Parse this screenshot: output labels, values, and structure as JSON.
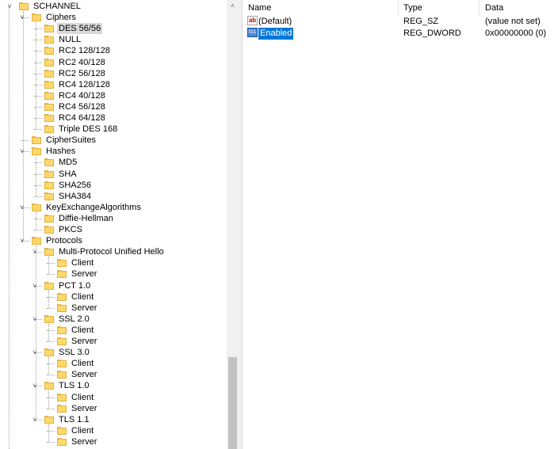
{
  "tree": {
    "rows": [
      {
        "label": "SCHANNEL",
        "expander": "˅",
        "selected": false
      },
      {
        "label": "Ciphers",
        "expander": "˅",
        "selected": false
      },
      {
        "label": "DES 56/56",
        "expander": "",
        "selected": true
      },
      {
        "label": "NULL",
        "expander": "",
        "selected": false
      },
      {
        "label": "RC2 128/128",
        "expander": "",
        "selected": false
      },
      {
        "label": "RC2 40/128",
        "expander": "",
        "selected": false
      },
      {
        "label": "RC2 56/128",
        "expander": "",
        "selected": false
      },
      {
        "label": "RC4 128/128",
        "expander": "",
        "selected": false
      },
      {
        "label": "RC4 40/128",
        "expander": "",
        "selected": false
      },
      {
        "label": "RC4 56/128",
        "expander": "",
        "selected": false
      },
      {
        "label": "RC4 64/128",
        "expander": "",
        "selected": false
      },
      {
        "label": "Triple DES 168",
        "expander": "",
        "selected": false
      },
      {
        "label": "CipherSuites",
        "expander": "",
        "selected": false
      },
      {
        "label": "Hashes",
        "expander": "˅",
        "selected": false
      },
      {
        "label": "MD5",
        "expander": "",
        "selected": false
      },
      {
        "label": "SHA",
        "expander": "",
        "selected": false
      },
      {
        "label": "SHA256",
        "expander": "",
        "selected": false
      },
      {
        "label": "SHA384",
        "expander": "",
        "selected": false
      },
      {
        "label": "KeyExchangeAlgorithms",
        "expander": "˅",
        "selected": false
      },
      {
        "label": "Diffie-Hellman",
        "expander": "",
        "selected": false
      },
      {
        "label": "PKCS",
        "expander": "",
        "selected": false
      },
      {
        "label": "Protocols",
        "expander": "˅",
        "selected": false
      },
      {
        "label": "Multi-Protocol Unified Hello",
        "expander": "˅",
        "selected": false
      },
      {
        "label": "Client",
        "expander": "",
        "selected": false
      },
      {
        "label": "Server",
        "expander": "",
        "selected": false
      },
      {
        "label": "PCT 1.0",
        "expander": "˅",
        "selected": false
      },
      {
        "label": "Client",
        "expander": "",
        "selected": false
      },
      {
        "label": "Server",
        "expander": "",
        "selected": false
      },
      {
        "label": "SSL 2.0",
        "expander": "˅",
        "selected": false
      },
      {
        "label": "Client",
        "expander": "",
        "selected": false
      },
      {
        "label": "Server",
        "expander": "",
        "selected": false
      },
      {
        "label": "SSL 3.0",
        "expander": "˅",
        "selected": false
      },
      {
        "label": "Client",
        "expander": "",
        "selected": false
      },
      {
        "label": "Server",
        "expander": "",
        "selected": false
      },
      {
        "label": "TLS 1.0",
        "expander": "˅",
        "selected": false
      },
      {
        "label": "Client",
        "expander": "",
        "selected": false
      },
      {
        "label": "Server",
        "expander": "",
        "selected": false
      },
      {
        "label": "TLS 1.1",
        "expander": "˅",
        "selected": false
      },
      {
        "label": "Client",
        "expander": "",
        "selected": false
      },
      {
        "label": "Server",
        "expander": "",
        "selected": false
      }
    ]
  },
  "scrollbar": {
    "up_arrow": "˄",
    "down_arrow": "˅"
  },
  "list": {
    "columns": {
      "name": "Name",
      "type": "Type",
      "data": "Data"
    },
    "rows": [
      {
        "icon": "ab",
        "icon_name": "string-value-icon",
        "name": "(Default)",
        "type": "REG_SZ",
        "data": "(value not set)",
        "selected": false
      },
      {
        "icon": "011",
        "icon_name": "binary-value-icon",
        "name": "Enabled",
        "type": "REG_DWORD",
        "data": "0x00000000 (0)",
        "selected": true
      }
    ]
  },
  "colors": {
    "selection": "#0078d7",
    "tree_selection": "#d9d9d9",
    "folder": "#ffd86b"
  }
}
